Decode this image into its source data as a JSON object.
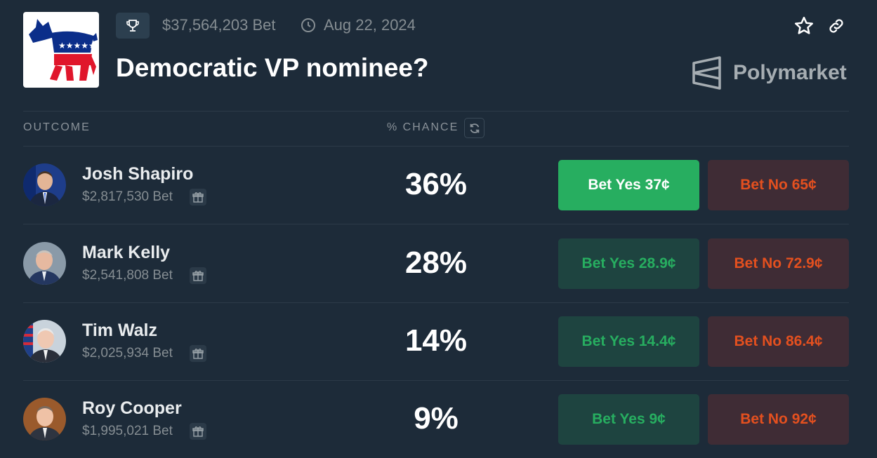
{
  "header": {
    "volume": "$37,564,203 Bet",
    "end_date": "Aug 22, 2024",
    "title": "Democratic VP nominee?",
    "brand": "Polymarket"
  },
  "columns": {
    "outcome": "OUTCOME",
    "chance": "% CHANCE"
  },
  "outcomes": [
    {
      "name": "Josh Shapiro",
      "volume": "$2,817,530 Bet",
      "chance": "36%",
      "yes": "Bet Yes 37¢",
      "no": "Bet No 65¢",
      "selected": true
    },
    {
      "name": "Mark Kelly",
      "volume": "$2,541,808 Bet",
      "chance": "28%",
      "yes": "Bet Yes 28.9¢",
      "no": "Bet No 72.9¢",
      "selected": false
    },
    {
      "name": "Tim Walz",
      "volume": "$2,025,934 Bet",
      "chance": "14%",
      "yes": "Bet Yes 14.4¢",
      "no": "Bet No 86.4¢",
      "selected": false
    },
    {
      "name": "Roy Cooper",
      "volume": "$1,995,021 Bet",
      "chance": "9%",
      "yes": "Bet Yes 9¢",
      "no": "Bet No 92¢",
      "selected": false
    }
  ],
  "colors": {
    "background": "#1d2b39",
    "yes_active": "#27ae60",
    "yes_text": "#27ae60",
    "no_text": "#e4501f"
  },
  "icons": [
    "trophy-icon",
    "clock-icon",
    "star-icon",
    "link-icon",
    "polymarket-logo-icon",
    "refresh-icon",
    "gift-icon"
  ]
}
